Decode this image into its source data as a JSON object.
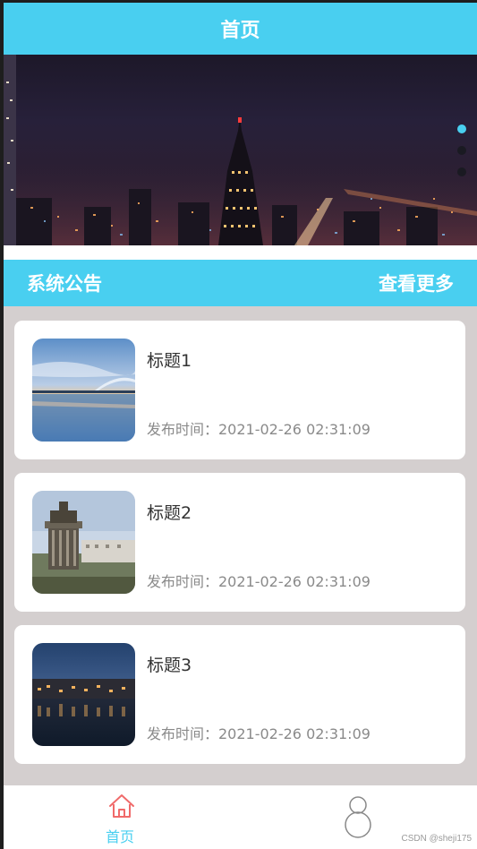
{
  "header": {
    "title": "首页"
  },
  "banner": {
    "slide_count": 3,
    "active_index": 0
  },
  "notice": {
    "title": "系统公告",
    "more_label": "查看更多"
  },
  "posts": [
    {
      "title": "标题1",
      "time": "发布时间：2021-02-26 02:31:09",
      "image": "bridge-sunset-thumbnail"
    },
    {
      "title": "标题2",
      "time": "发布时间：2021-02-26 02:31:09",
      "image": "monument-city-thumbnail"
    },
    {
      "title": "标题3",
      "time": "发布时间：2021-02-26 02:31:09",
      "image": "night-waterfront-thumbnail"
    }
  ],
  "tabbar": {
    "home_label": "首页",
    "home_icon": "home-icon",
    "user_icon": "user-icon"
  },
  "watermark": "CSDN @sheji175",
  "colors": {
    "accent": "#49cff0",
    "background": "#d4cfcf",
    "home_icon": "#f06a6a"
  }
}
